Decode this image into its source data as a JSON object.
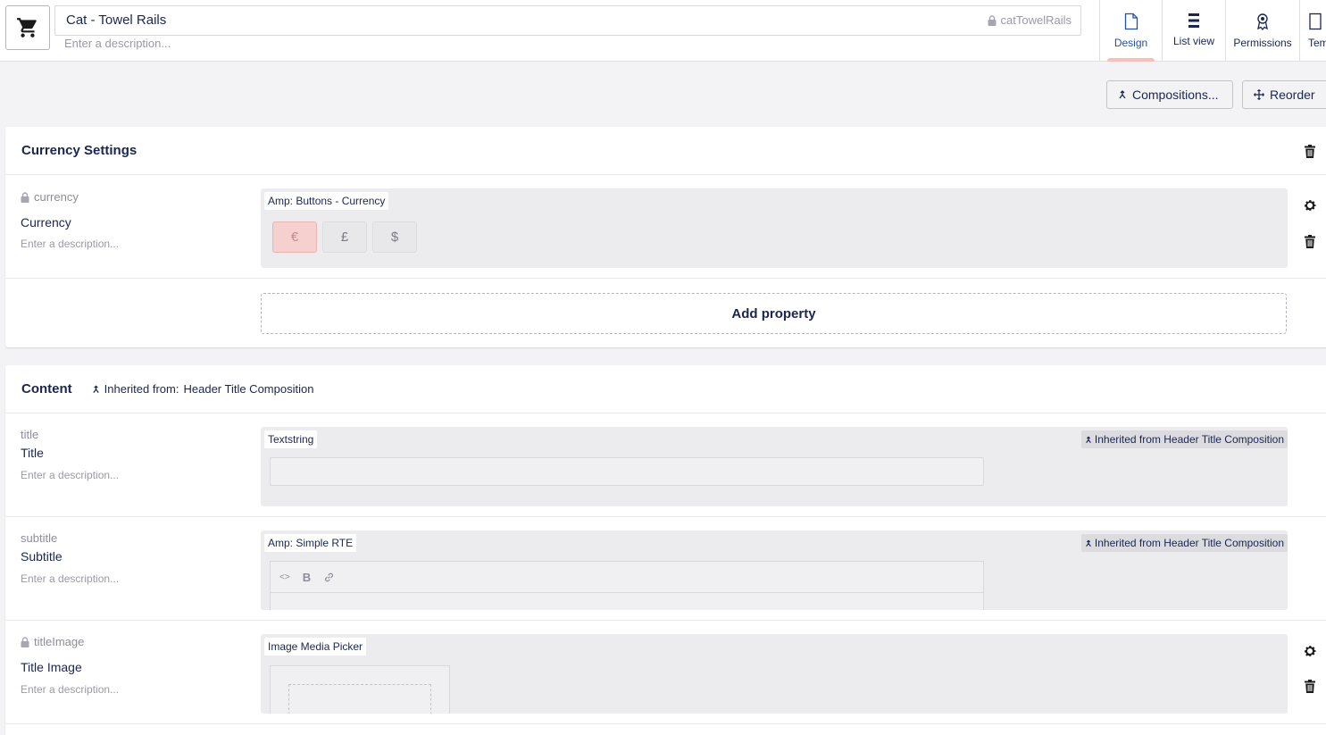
{
  "header": {
    "name": "Cat - Towel Rails",
    "alias": "catTowelRails",
    "description_placeholder": "Enter a description..."
  },
  "apps": [
    {
      "label": "Design",
      "icon": "document-icon",
      "active": true
    },
    {
      "label": "List view",
      "icon": "list-icon",
      "active": false
    },
    {
      "label": "Permissions",
      "icon": "award-icon",
      "active": false
    },
    {
      "label": "Templates",
      "icon": "template-icon",
      "active": false
    }
  ],
  "toolbar": {
    "compositions_label": "Compositions...",
    "reorder_label": "Reorder"
  },
  "groups": [
    {
      "title": "Currency Settings",
      "properties": [
        {
          "alias": "currency",
          "name": "Currency",
          "description": "Enter a description...",
          "editor": "Amp: Buttons - Currency",
          "currency_buttons": [
            "€",
            "£",
            "$"
          ]
        }
      ],
      "add_property_label": "Add property"
    },
    {
      "title": "Content",
      "inherited_prefix": "Inherited from:",
      "inherited_source": "Header Title Composition",
      "properties": [
        {
          "alias": "title",
          "name": "Title",
          "description": "Enter a description...",
          "editor": "Textstring",
          "inherited_tag": "Inherited from Header Title Composition"
        },
        {
          "alias": "subtitle",
          "name": "Subtitle",
          "description": "Enter a description...",
          "editor": "Amp: Simple RTE",
          "inherited_tag": "Inherited from Header Title Composition",
          "rte_tools": [
            "<>",
            "B"
          ]
        },
        {
          "alias": "titleImage",
          "name": "Title Image",
          "description": "Enter a description...",
          "editor": "Image Media Picker"
        }
      ]
    }
  ]
}
